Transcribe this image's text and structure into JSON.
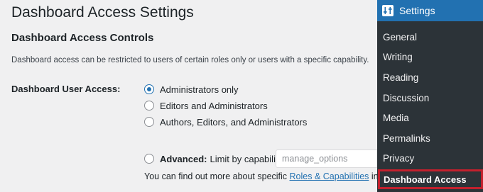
{
  "page": {
    "title": "Dashboard Access Settings",
    "section_title": "Dashboard Access Controls",
    "description": "Dashboard access can be restricted to users of certain roles only or users with a specific capability.",
    "field_label": "Dashboard User Access:",
    "options": [
      {
        "label": "Administrators only",
        "checked": true
      },
      {
        "label": "Editors and Administrators",
        "checked": false
      },
      {
        "label": "Authors, Editors, and Administrators",
        "checked": false
      }
    ],
    "advanced": {
      "strong": "Advanced:",
      "text": "Limit by capability:",
      "input_placeholder": "manage_options",
      "checked": false
    },
    "more_info": {
      "prefix": "You can find out more about specific ",
      "link": "Roles & Capabilities",
      "suffix": " in the"
    }
  },
  "sidebar": {
    "heading": "Settings",
    "heading_icon": "settings-sliders-icon",
    "items": [
      {
        "label": "General"
      },
      {
        "label": "Writing"
      },
      {
        "label": "Reading"
      },
      {
        "label": "Discussion"
      },
      {
        "label": "Media"
      },
      {
        "label": "Permalinks"
      },
      {
        "label": "Privacy"
      }
    ],
    "active_item": "Dashboard Access"
  },
  "colors": {
    "accent": "#2271b1",
    "sidebar_bg": "#2c3338",
    "highlight_border": "#c3202d",
    "page_bg": "#f0f0f1"
  }
}
